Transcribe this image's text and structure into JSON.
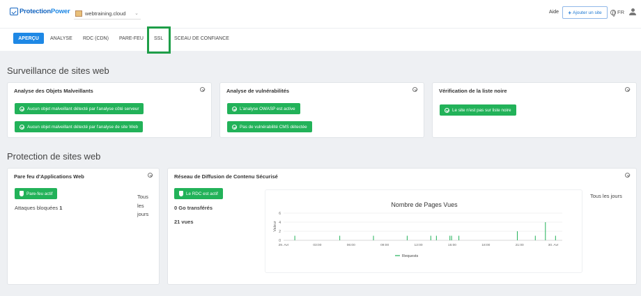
{
  "topbar": {
    "logo_prefix": "Protection",
    "logo_suffix": "Power",
    "site": "webtraining.cloud",
    "help": "Aide",
    "add_site": "Ajouter un site",
    "lang": "FR"
  },
  "tabs": [
    {
      "label": "APERÇU",
      "active": true
    },
    {
      "label": "ANALYSE"
    },
    {
      "label": "RDC (CDN)"
    },
    {
      "label": "PARE-FEU"
    },
    {
      "label": "SSL"
    },
    {
      "label": "SCEAU DE CONFIANCE"
    }
  ],
  "monitoring": {
    "title": "Surveillance de sites web",
    "malware": {
      "title": "Analyse des Objets Malveillants",
      "items": [
        "Aucun objet malveillant détecté par l'analyse côté serveur",
        "Aucun objet malveillant détecté par l'analyse de site Web"
      ]
    },
    "vuln": {
      "title": "Analyse de vulnérabilités",
      "items": [
        "L'analyse OWASP est active",
        "Pas de vulnérabilité CMS détectée"
      ]
    },
    "blacklist": {
      "title": "Vérification de la liste noire",
      "items": [
        "Le site n'est pas sur liste noire"
      ]
    }
  },
  "protection": {
    "title": "Protection de sites web",
    "waf": {
      "title": "Pare feu d'Applications Web",
      "status": "Pare-feu actif",
      "blocked_label": "Attaques bloquées",
      "blocked_value": "1",
      "period": "Tous les jours"
    },
    "cdn": {
      "title": "Réseau de Diffusion de Contenu Sécurisé",
      "status": "Le RDC est actif",
      "transferred": "0 Go transférés",
      "views": "21 vues",
      "period": "Tous les jours"
    }
  },
  "chart_data": {
    "type": "bar",
    "title": "Nombre de Pages Vues",
    "ylabel": "Valeur",
    "ylim": [
      0,
      6
    ],
    "yticks": [
      0,
      2,
      4,
      6
    ],
    "xticks": [
      "29. Avr",
      "03:00",
      "06:00",
      "09:00",
      "12:00",
      "15:00",
      "18:00",
      "21:00",
      "30. Avr"
    ],
    "x_hours": [
      0,
      3,
      6,
      9,
      12,
      15,
      18,
      21,
      24
    ],
    "series": [
      {
        "name": "Requests",
        "color": "#22b259",
        "x": [
          1.0,
          5.0,
          8.0,
          11.0,
          13.1,
          13.6,
          14.8,
          14.95,
          15.6,
          20.8,
          22.4,
          23.3,
          24.2
        ],
        "values": [
          1,
          1,
          1,
          1,
          1,
          1,
          1,
          1,
          1,
          2,
          1,
          4,
          1
        ]
      }
    ]
  }
}
